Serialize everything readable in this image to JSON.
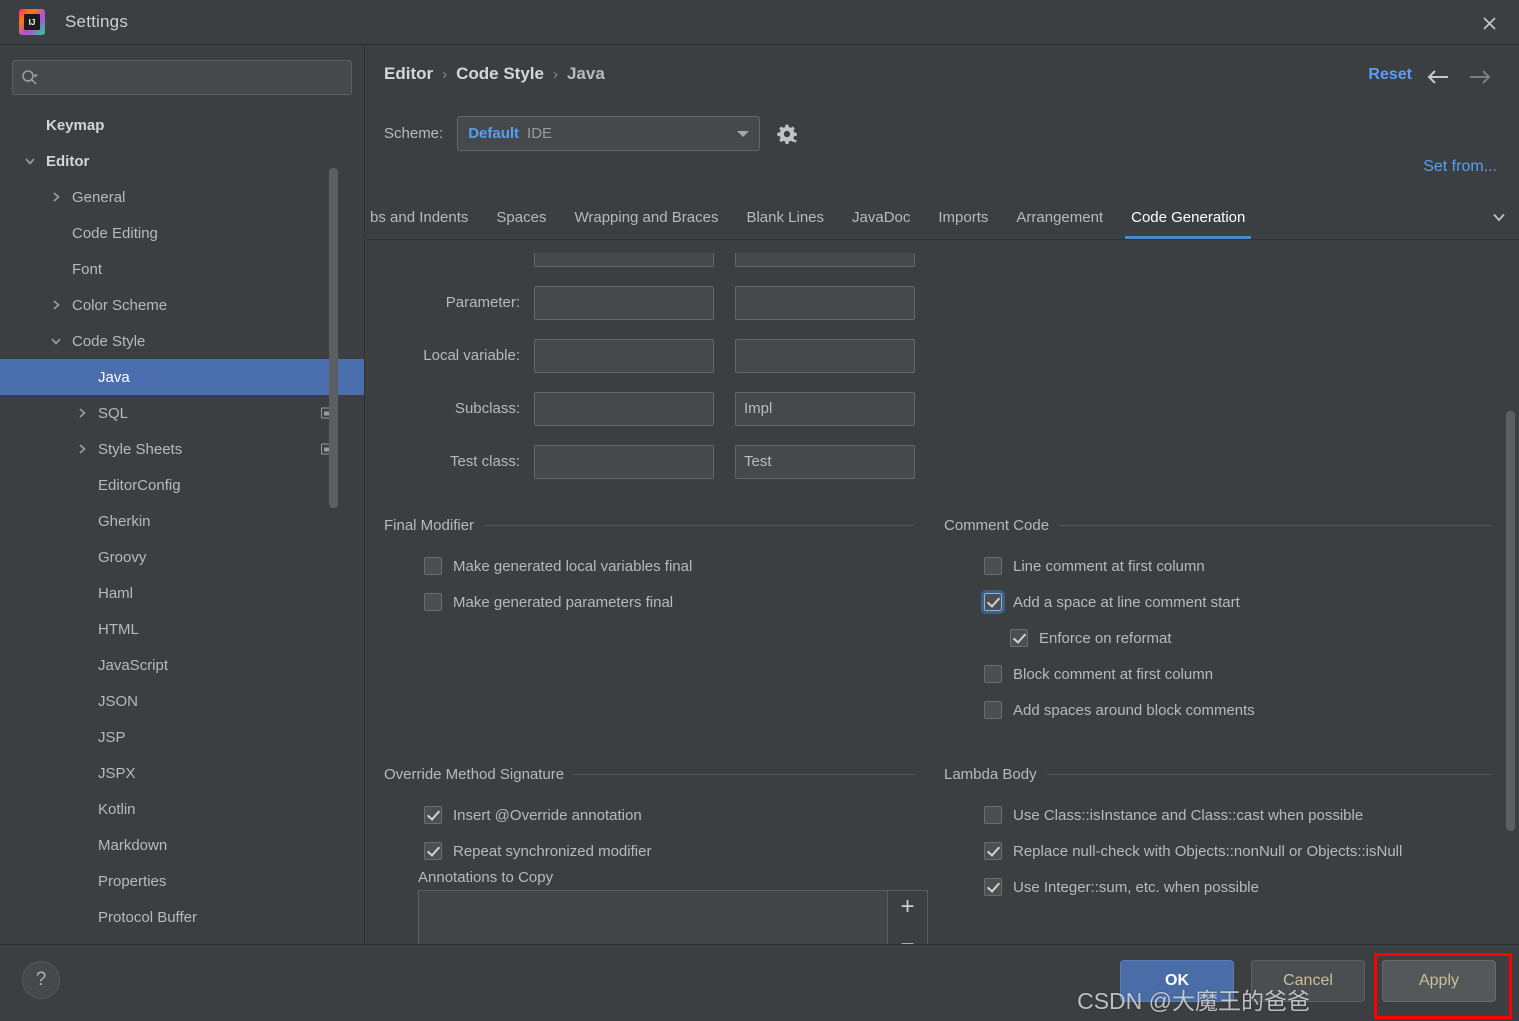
{
  "window": {
    "title": "Settings",
    "logo_text": "IJ",
    "close_icon": "close-icon"
  },
  "sidebar": {
    "search": {
      "placeholder": "",
      "value": "",
      "icon": "search-icon"
    },
    "items": [
      {
        "label": "Keymap",
        "indent": 0,
        "arrow": "none",
        "bold": true,
        "selected": false,
        "badge": false
      },
      {
        "label": "Editor",
        "indent": 0,
        "arrow": "down",
        "bold": true,
        "selected": false,
        "badge": false
      },
      {
        "label": "General",
        "indent": 1,
        "arrow": "right",
        "bold": false,
        "selected": false,
        "badge": false
      },
      {
        "label": "Code Editing",
        "indent": 1,
        "arrow": "none",
        "bold": false,
        "selected": false,
        "badge": false
      },
      {
        "label": "Font",
        "indent": 1,
        "arrow": "none",
        "bold": false,
        "selected": false,
        "badge": false
      },
      {
        "label": "Color Scheme",
        "indent": 1,
        "arrow": "right",
        "bold": false,
        "selected": false,
        "badge": false
      },
      {
        "label": "Code Style",
        "indent": 1,
        "arrow": "down",
        "bold": false,
        "selected": false,
        "badge": false
      },
      {
        "label": "Java",
        "indent": 2,
        "arrow": "none",
        "bold": false,
        "selected": true,
        "badge": false
      },
      {
        "label": "SQL",
        "indent": 2,
        "arrow": "right",
        "bold": false,
        "selected": false,
        "badge": true
      },
      {
        "label": "Style Sheets",
        "indent": 2,
        "arrow": "right",
        "bold": false,
        "selected": false,
        "badge": true
      },
      {
        "label": "EditorConfig",
        "indent": 2,
        "arrow": "none",
        "bold": false,
        "selected": false,
        "badge": false
      },
      {
        "label": "Gherkin",
        "indent": 2,
        "arrow": "none",
        "bold": false,
        "selected": false,
        "badge": false
      },
      {
        "label": "Groovy",
        "indent": 2,
        "arrow": "none",
        "bold": false,
        "selected": false,
        "badge": false
      },
      {
        "label": "Haml",
        "indent": 2,
        "arrow": "none",
        "bold": false,
        "selected": false,
        "badge": false
      },
      {
        "label": "HTML",
        "indent": 2,
        "arrow": "none",
        "bold": false,
        "selected": false,
        "badge": false
      },
      {
        "label": "JavaScript",
        "indent": 2,
        "arrow": "none",
        "bold": false,
        "selected": false,
        "badge": false
      },
      {
        "label": "JSON",
        "indent": 2,
        "arrow": "none",
        "bold": false,
        "selected": false,
        "badge": false
      },
      {
        "label": "JSP",
        "indent": 2,
        "arrow": "none",
        "bold": false,
        "selected": false,
        "badge": false
      },
      {
        "label": "JSPX",
        "indent": 2,
        "arrow": "none",
        "bold": false,
        "selected": false,
        "badge": false
      },
      {
        "label": "Kotlin",
        "indent": 2,
        "arrow": "none",
        "bold": false,
        "selected": false,
        "badge": false
      },
      {
        "label": "Markdown",
        "indent": 2,
        "arrow": "none",
        "bold": false,
        "selected": false,
        "badge": false
      },
      {
        "label": "Properties",
        "indent": 2,
        "arrow": "none",
        "bold": false,
        "selected": false,
        "badge": false
      },
      {
        "label": "Protocol Buffer",
        "indent": 2,
        "arrow": "none",
        "bold": false,
        "selected": false,
        "badge": false
      }
    ]
  },
  "header": {
    "breadcrumb": [
      "Editor",
      "Code Style",
      "Java"
    ],
    "separator": "›",
    "reset_label": "Reset",
    "back_icon": "arrow-left-icon",
    "forward_icon": "arrow-right-icon",
    "set_from_label": "Set from...",
    "scheme_label": "Scheme:",
    "scheme_value": "Default",
    "scheme_scope": "IDE",
    "gear_icon": "gear-icon"
  },
  "tabs": {
    "items": [
      {
        "label": "bs and Indents",
        "active": false
      },
      {
        "label": "Spaces",
        "active": false
      },
      {
        "label": "Wrapping and Braces",
        "active": false
      },
      {
        "label": "Blank Lines",
        "active": false
      },
      {
        "label": "JavaDoc",
        "active": false
      },
      {
        "label": "Imports",
        "active": false
      },
      {
        "label": "Arrangement",
        "active": false
      },
      {
        "label": "Code Generation",
        "active": true
      }
    ],
    "overflow_icon": "chevron-down-icon"
  },
  "naming_fields": [
    {
      "label": "Parameter:",
      "prefix": "",
      "suffix": ""
    },
    {
      "label": "Local variable:",
      "prefix": "",
      "suffix": ""
    },
    {
      "label": "Subclass:",
      "prefix": "",
      "suffix": "Impl"
    },
    {
      "label": "Test class:",
      "prefix": "",
      "suffix": "Test"
    }
  ],
  "sections": {
    "final_modifier": {
      "title": "Final Modifier",
      "options": [
        {
          "label": "Make generated local variables final",
          "checked": false,
          "focused": false,
          "indent": 0
        },
        {
          "label": "Make generated parameters final",
          "checked": false,
          "focused": false,
          "indent": 0
        }
      ]
    },
    "comment_code": {
      "title": "Comment Code",
      "options": [
        {
          "label": "Line comment at first column",
          "checked": false,
          "focused": false,
          "indent": 0
        },
        {
          "label": "Add a space at line comment start",
          "checked": true,
          "focused": true,
          "indent": 0
        },
        {
          "label": "Enforce on reformat",
          "checked": true,
          "focused": false,
          "indent": 1
        },
        {
          "label": "Block comment at first column",
          "checked": false,
          "focused": false,
          "indent": 0
        },
        {
          "label": "Add spaces around block comments",
          "checked": false,
          "focused": false,
          "indent": 0
        }
      ]
    },
    "override_method_signature": {
      "title": "Override Method Signature",
      "options": [
        {
          "label": "Insert @Override annotation",
          "checked": true,
          "focused": false,
          "indent": 0
        },
        {
          "label": "Repeat synchronized modifier",
          "checked": true,
          "focused": false,
          "indent": 0
        }
      ],
      "list_label": "Annotations to Copy",
      "list_items": [],
      "add_label": "+",
      "remove_label": "−"
    },
    "lambda_body": {
      "title": "Lambda Body",
      "options": [
        {
          "label": "Use Class::isInstance and Class::cast when possible",
          "checked": false,
          "focused": false,
          "indent": 0
        },
        {
          "label": "Replace null-check with Objects::nonNull or Objects::isNull",
          "checked": true,
          "focused": false,
          "indent": 0
        },
        {
          "label": "Use Integer::sum, etc. when possible",
          "checked": true,
          "focused": false,
          "indent": 0
        }
      ]
    }
  },
  "footer": {
    "help_label": "?",
    "ok_label": "OK",
    "cancel_label": "Cancel",
    "apply_label": "Apply"
  },
  "overlay": {
    "watermark": "CSDN @大魔王的爸爸",
    "highlight_color": "#ff0000"
  },
  "colors": {
    "background": "#3c3f41",
    "selection": "#4b6eaf",
    "link": "#589df6",
    "accent_tab": "#4a88c7",
    "ok_button": "#4a6da7"
  }
}
